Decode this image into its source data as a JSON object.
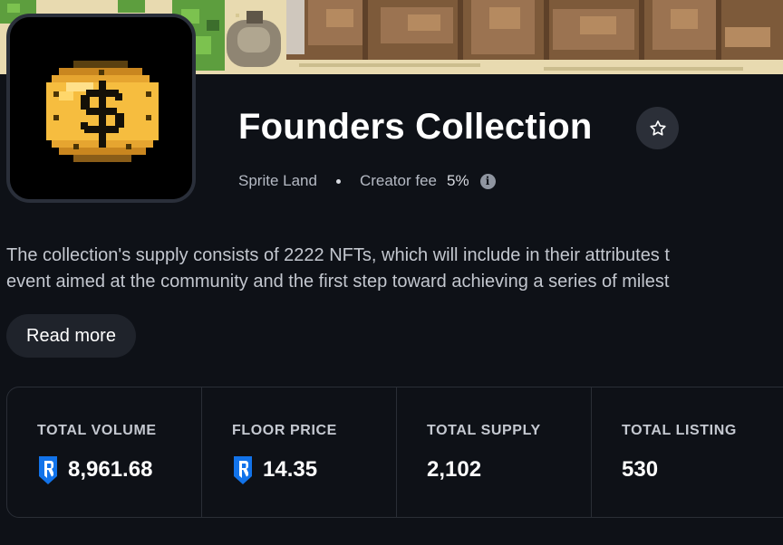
{
  "collection": {
    "title": "Founders Collection",
    "creator": "Sprite Land",
    "creator_fee_label": "Creator fee",
    "creator_fee_value": "5%",
    "description_line1": "The collection's supply consists of 2222 NFTs, which will include in their attributes t",
    "description_line2": "event aimed at the community and the first step toward achieving a series of milest",
    "read_more_label": "Read more"
  },
  "icons": {
    "favorite": "star-outline-icon",
    "info": "info-circle-icon",
    "currency": "ronin-shield-icon",
    "avatar": "gold-dollar-coin-pixel-art"
  },
  "stats": [
    {
      "label": "TOTAL VOLUME",
      "value": "8,961.68",
      "currency_icon": true
    },
    {
      "label": "FLOOR PRICE",
      "value": "14.35",
      "currency_icon": true
    },
    {
      "label": "TOTAL SUPPLY",
      "value": "2,102",
      "currency_icon": false
    },
    {
      "label": "TOTAL LISTING",
      "value": "530",
      "currency_icon": false
    }
  ],
  "colors": {
    "background": "#0e1117",
    "accent_blue": "#1273ea",
    "coin_gold": "#f2b83a"
  }
}
